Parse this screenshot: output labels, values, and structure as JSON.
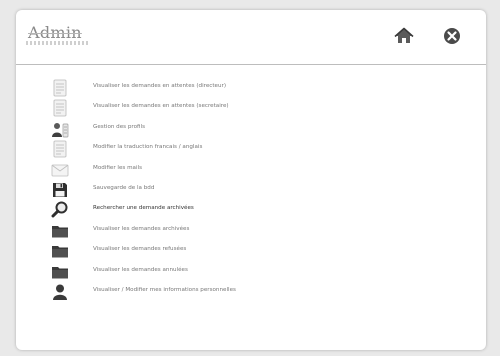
{
  "header": {
    "title": "Admin",
    "home_icon": "home-icon",
    "close_icon": "close-icon"
  },
  "colors": {
    "background": "#e9e9e9",
    "card": "#ffffff",
    "icon_dark": "#3a3a3a",
    "icon_light": "#c8c8c8"
  },
  "menu": {
    "items": [
      {
        "icon": "document-icon",
        "label": "Visualiser les demandes en attentes (directeur)"
      },
      {
        "icon": "document-icon",
        "label": "Visualiser les demandes en attentes (secretaire)"
      },
      {
        "icon": "profiles-icon",
        "label": "Gestion des profils"
      },
      {
        "icon": "document-icon",
        "label": "Modifier la traduction francais / anglais"
      },
      {
        "icon": "mail-icon",
        "label": "Modifier les mails"
      },
      {
        "icon": "floppy-disk-icon",
        "label": "Sauvegarde de la bdd"
      },
      {
        "icon": "magnifier-icon",
        "label": "Rechercher une demande archivées"
      },
      {
        "icon": "folder-icon",
        "label": "Visualiser les demandes archivées"
      },
      {
        "icon": "folder-icon",
        "label": "Visualiser les demandes refusées"
      },
      {
        "icon": "folder-icon",
        "label": "Visualiser les demandes annulées"
      },
      {
        "icon": "user-icon",
        "label": "Visualiser / Modifier mes informations personnelles"
      }
    ]
  }
}
